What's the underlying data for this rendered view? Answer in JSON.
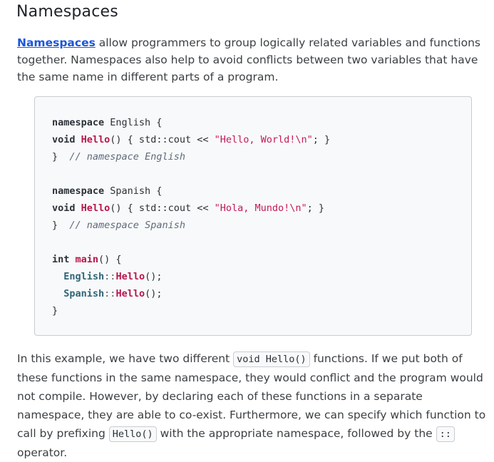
{
  "title": "Namespaces",
  "intro": {
    "link_text": "Namespaces",
    "text": " allow programmers to group logically related variables and functions together. Namespaces also help to avoid conflicts between two variables that have the same name in different parts of a program."
  },
  "code": {
    "namespace_kw": "namespace",
    "void_kw": "void",
    "int_kw": "int",
    "hello_fn": "Hello",
    "main_fn": "main",
    "english_ns": "English",
    "spanish_ns": "Spanish",
    "english_open": " English {",
    "spanish_open": " Spanish {",
    "paren_open": "() { std::cout << ",
    "hello_world_str": "\"Hello, World!\\n\"",
    "hola_mundo_str": "\"Hola, Mundo!\\n\"",
    "stmt_close": "; }",
    "close_brace": "}",
    "english_comment": "// namespace English",
    "spanish_comment": "// namespace Spanish",
    "main_open": "() {",
    "scope_op": "::",
    "call_end": "();"
  },
  "outro": {
    "part1": "In this example, we have two different ",
    "code1": "void Hello()",
    "part2": " functions. If we put both of these functions in the same namespace, they would conflict and the program would not compile. However, by declaring each of these functions in a separate namespace, they are able to co-exist. Furthermore, we can specify which function to call by prefixing ",
    "code2": "Hello()",
    "part3": " with the appropriate namespace, followed by the ",
    "code3": "::",
    "part4": " operator."
  }
}
